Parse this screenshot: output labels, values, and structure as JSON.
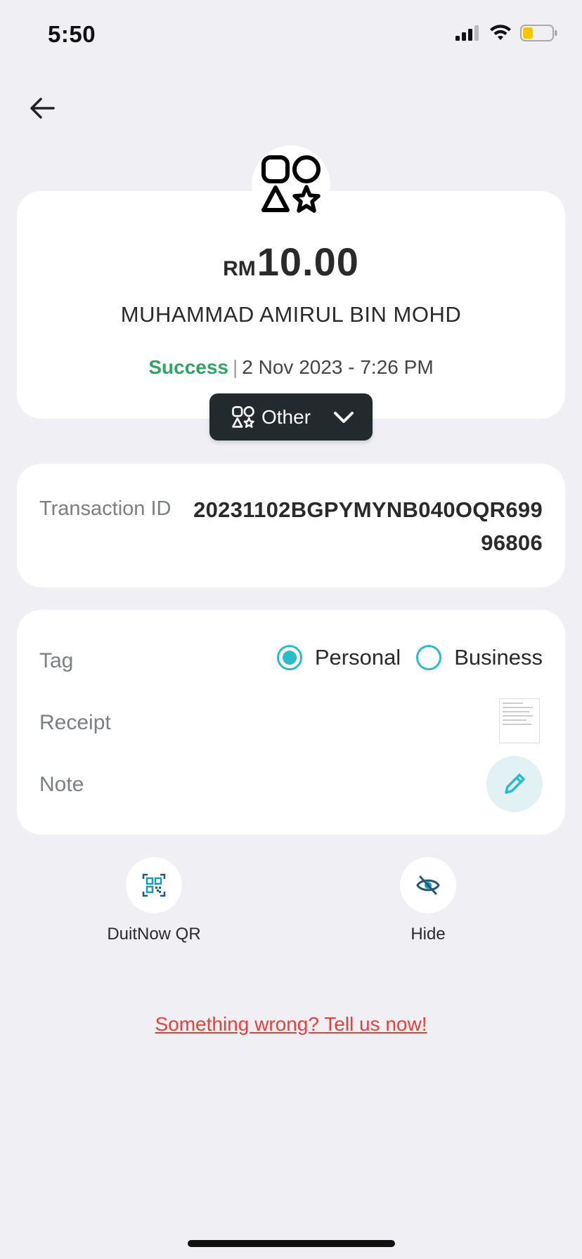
{
  "status_bar": {
    "time": "5:50",
    "battery_color": "#F7C600"
  },
  "header": {
    "back_icon": "arrow-left-icon"
  },
  "summary": {
    "category_icon": "shapes-icon",
    "currency": "RM",
    "amount": "10.00",
    "recipient": "MUHAMMAD AMIRUL BIN MOHD",
    "status": "Success",
    "separator": "|",
    "datetime": "2 Nov 2023 - 7:26 PM",
    "status_color": "#2FA463"
  },
  "category_dropdown": {
    "label": "Other",
    "icon": "shapes-icon",
    "chevron": "chevron-down-icon"
  },
  "transaction": {
    "label": "Transaction ID",
    "value": "20231102BGPYMYNB040OQR69996806"
  },
  "details": {
    "tag_label": "Tag",
    "tag_options": [
      {
        "label": "Personal",
        "selected": true
      },
      {
        "label": "Business",
        "selected": false
      }
    ],
    "receipt_label": "Receipt",
    "note_label": "Note",
    "accent_color": "#2BBCCB"
  },
  "actions": [
    {
      "label": "DuitNow QR",
      "icon": "qr-code-icon"
    },
    {
      "label": "Hide",
      "icon": "eye-off-icon"
    }
  ],
  "report_link": "Something wrong? Tell us now!",
  "report_color": "#E8413C"
}
